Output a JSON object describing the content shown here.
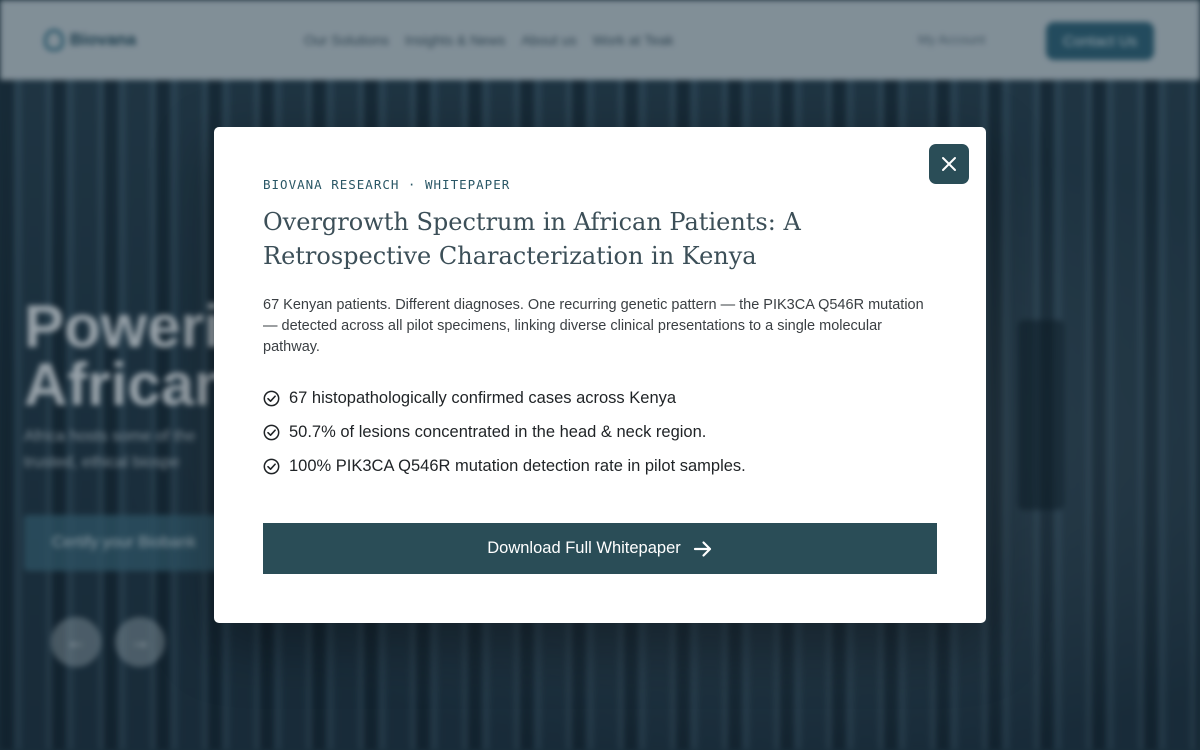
{
  "background": {
    "nav": {
      "logo_text": "Biovana",
      "menu": [
        "Our Solutions",
        "Insights & News",
        "About us",
        "Work at Teak"
      ],
      "account_label": "My Account",
      "cta_label": "Contact Us"
    },
    "hero": {
      "headline": "Powering\nAfrican",
      "subtext": "Africa hosts some of the\ntrusted, ethical biospe",
      "button_label": "Certify your Biobank",
      "prev_arrow": "←",
      "next_arrow": "→"
    }
  },
  "modal": {
    "eyebrow": "BIOVANA RESEARCH · WHITEPAPER",
    "title": "Overgrowth Spectrum in African Patients: A Retrospective Characterization in Kenya",
    "description": "67 Kenyan patients. Different diagnoses. One recurring genetic pattern — the PIK3CA Q546R mutation — detected across all pilot specimens, linking diverse clinical presentations to a single molecular pathway.",
    "bullets": [
      "67 histopathologically confirmed cases across Kenya",
      "50.7% of lesions concentrated in the head & neck region.",
      "100% PIK3CA Q546R mutation detection rate in pilot samples."
    ],
    "download_label": "Download Full Whitepaper",
    "close_icon": "close-icon",
    "check_icon": "check-circle-icon",
    "arrow_icon": "arrow-right-icon"
  },
  "colors": {
    "accent": "#2a4d57",
    "eyebrow": "#2a5766",
    "title": "#3c4f58"
  }
}
